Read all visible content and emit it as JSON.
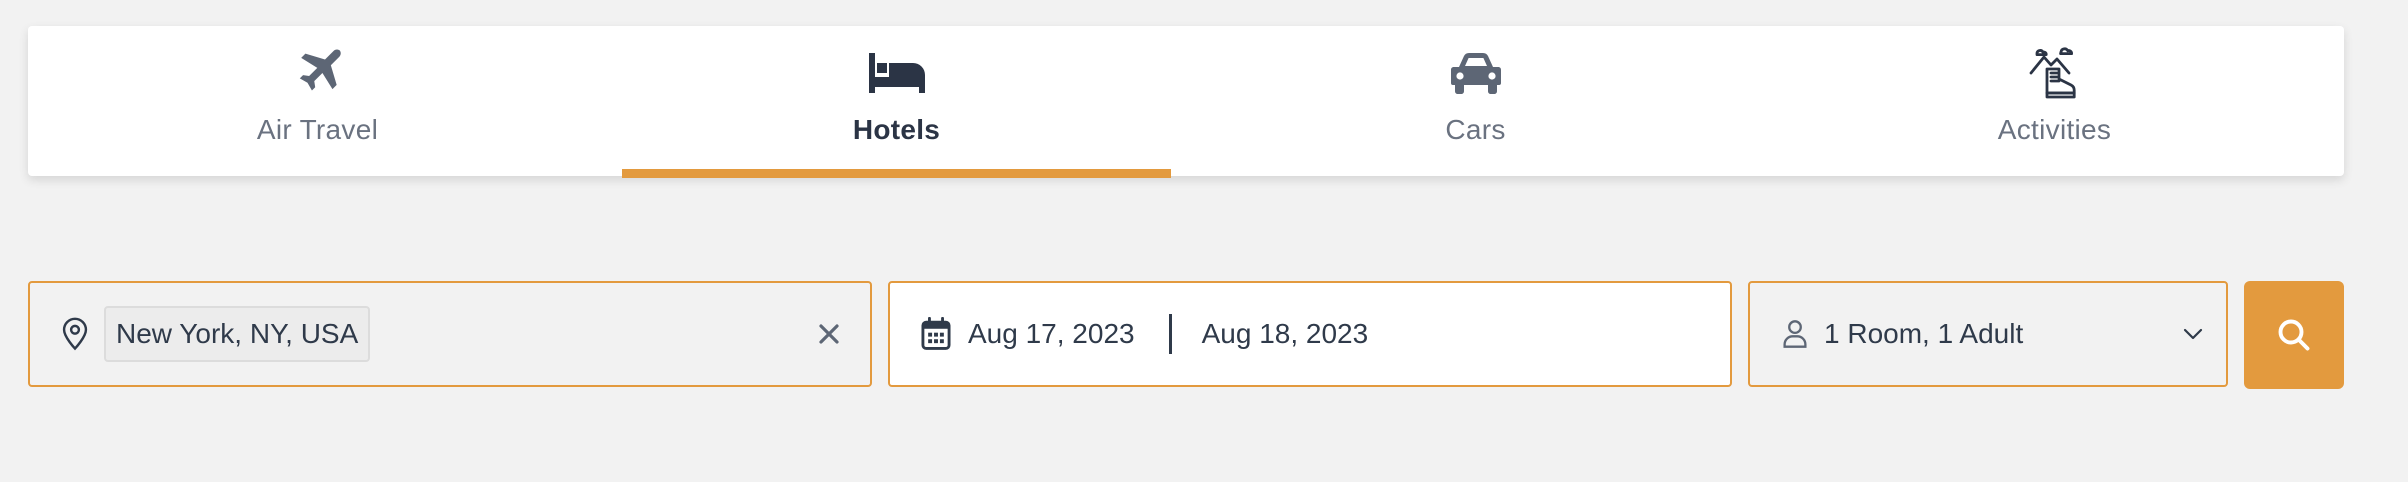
{
  "tabs": [
    {
      "label": "Air Travel",
      "icon": "plane-icon",
      "active": false
    },
    {
      "label": "Hotels",
      "icon": "bed-icon",
      "active": true
    },
    {
      "label": "Cars",
      "icon": "car-icon",
      "active": false
    },
    {
      "label": "Activities",
      "icon": "hiking-boot-icon",
      "active": false
    }
  ],
  "search": {
    "destination": "New York, NY, USA",
    "check_in": "Aug 17, 2023",
    "check_out": "Aug 18, 2023",
    "guests": "1 Room, 1 Adult"
  },
  "colors": {
    "accent": "#e39a3e",
    "text_dark": "#2b3445",
    "text_muted": "#6a7280",
    "icon_gray": "#5d6675",
    "background": "#f2f2f2"
  }
}
